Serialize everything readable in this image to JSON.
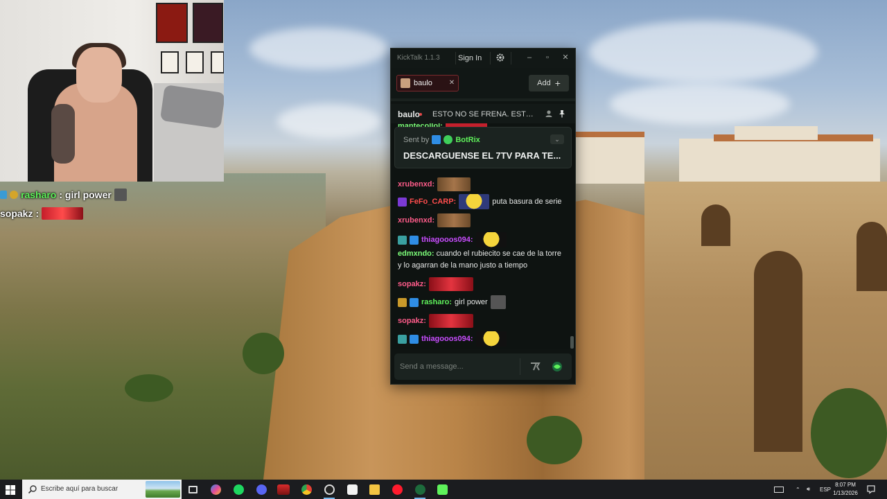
{
  "webcam_overlay": {
    "chat": [
      {
        "user": "rasharo",
        "text": ": girl power"
      },
      {
        "user": "sopakz",
        "text": ":"
      }
    ]
  },
  "kicktalk": {
    "title": "KickTalk 1.1.3",
    "sign_in": "Sign In",
    "tab": {
      "name": "baulo"
    },
    "add_label": "Add",
    "channel_header": {
      "name": "baulo",
      "title": "ESTO NO SE FRENA. ESTO..."
    },
    "pinned": {
      "sent_by_label": "Sent by",
      "bot_name": "BotRix",
      "text": "DESCARGUENSE EL 7TV PARA TE..."
    },
    "partial_top_user": "mantecollol:",
    "messages": [
      {
        "user": "xrubenxd:",
        "color": "#ff5c8a",
        "text": ""
      },
      {
        "user": "FeFo_CARP:",
        "color": "#ff4d4d",
        "text": "puta basura de serie"
      },
      {
        "user": "xrubenxd:",
        "color": "#ff5c8a",
        "text": ""
      },
      {
        "user": "thiagooos094:",
        "color": "#c94dff",
        "text": ""
      },
      {
        "user": "edmxndo:",
        "color": "#7dff7a",
        "text": "cuando el rubiecito se cae de la torre y lo agarran de la mano justo a tiempo"
      },
      {
        "user": "sopakz:",
        "color": "#ff5c8a",
        "text": ""
      },
      {
        "user": "rasharo:",
        "color": "#5ff25b",
        "text": "girl power"
      },
      {
        "user": "sopakz:",
        "color": "#ff5c8a",
        "text": ""
      },
      {
        "user": "thiagooos094:",
        "color": "#c94dff",
        "text": ""
      }
    ],
    "input_placeholder": "Send a message..."
  },
  "taskbar": {
    "search_placeholder": "Escribe aquí para buscar",
    "language": "ESP",
    "time": "8:07 PM",
    "date": "1/13/2026"
  },
  "colors": {
    "kick_green": "#5ff25b",
    "accent_red": "#e34848"
  }
}
